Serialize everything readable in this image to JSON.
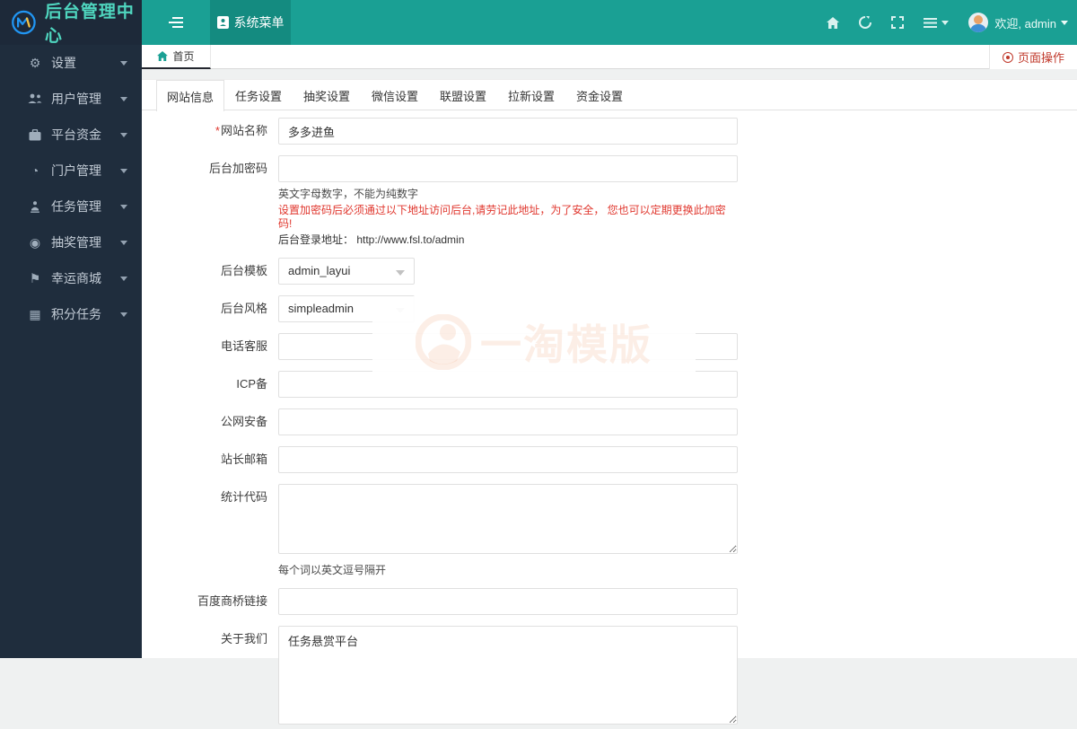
{
  "header": {
    "brand_title": "后台管理中心",
    "system_menu_label": "系统菜单",
    "welcome_label": "欢迎, admin"
  },
  "navstrip": {
    "home_tab": "首页",
    "page_actions": "页面操作"
  },
  "sidebar": {
    "items": [
      {
        "label": "设置",
        "icon": "gears-icon"
      },
      {
        "label": "用户管理",
        "icon": "users-icon"
      },
      {
        "label": "平台资金",
        "icon": "funds-icon"
      },
      {
        "label": "门户管理",
        "icon": "portal-icon"
      },
      {
        "label": "任务管理",
        "icon": "tasks-icon"
      },
      {
        "label": "抽奖管理",
        "icon": "lottery-icon"
      },
      {
        "label": "幸运商城",
        "icon": "mall-icon"
      },
      {
        "label": "积分任务",
        "icon": "points-icon"
      }
    ]
  },
  "content": {
    "tabs": [
      {
        "label": "网站信息"
      },
      {
        "label": "任务设置"
      },
      {
        "label": "抽奖设置"
      },
      {
        "label": "微信设置"
      },
      {
        "label": "联盟设置"
      },
      {
        "label": "拉新设置"
      },
      {
        "label": "资金设置"
      }
    ],
    "form": {
      "site_name": {
        "label": "网站名称",
        "required_mark": "*",
        "value": "多多进鱼"
      },
      "admin_password": {
        "label": "后台加密码",
        "value": "",
        "help": "英文字母数字，不能为纯数字",
        "warning": "设置加密码后必须通过以下地址访问后台,请劳记此地址，为了安全， 您也可以定期更换此加密码!",
        "address": "后台登录地址： http://www.fsl.to/admin"
      },
      "admin_template": {
        "label": "后台模板",
        "value": "admin_layui"
      },
      "admin_style": {
        "label": "后台风格",
        "value": "simpleadmin"
      },
      "phone_service": {
        "label": "电话客服",
        "value": ""
      },
      "icp": {
        "label": "ICP备",
        "value": ""
      },
      "public_security": {
        "label": "公网安备",
        "value": ""
      },
      "webmaster_email": {
        "label": "站长邮箱",
        "value": ""
      },
      "stats_code": {
        "label": "统计代码",
        "value": "",
        "help": "每个词以英文逗号隔开"
      },
      "baidu_bridge": {
        "label": "百度商桥链接",
        "value": ""
      },
      "about_us": {
        "label": "关于我们",
        "value": "任务悬赏平台"
      }
    },
    "watermark_text": "一淘模版"
  },
  "colors": {
    "accent_teal": "#1aa094",
    "accent_teal_dark": "#148b80",
    "sidebar_bg": "#1f2d3d",
    "brand_text": "#4fd6bf",
    "active_tab_underline": "#23262e",
    "danger_red": "#c0392b",
    "warning_red": "#e0372e"
  }
}
